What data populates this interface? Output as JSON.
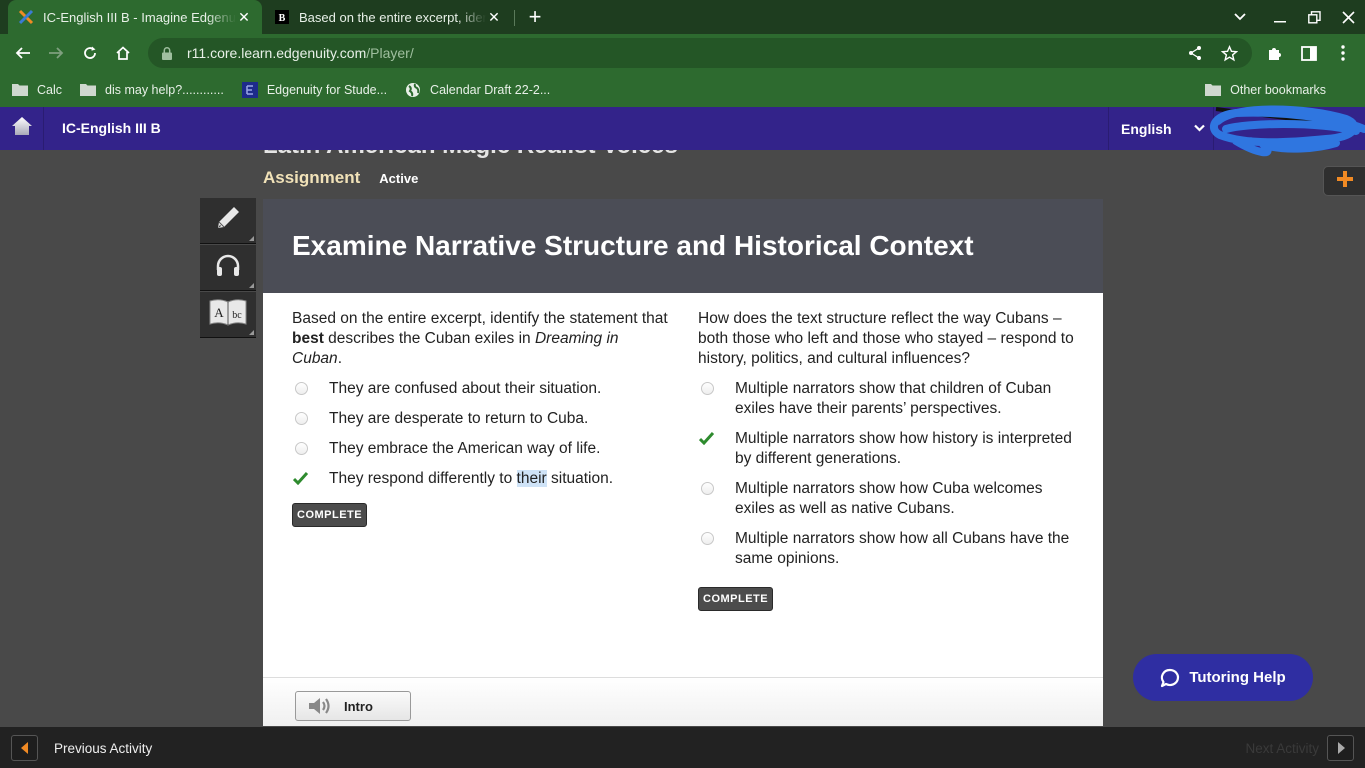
{
  "browser": {
    "tabs": [
      {
        "title": "IC-English III B - Imagine Edgenuity",
        "active": true,
        "favicon": "edgenuity-x-icon"
      },
      {
        "title": "Based on the entire excerpt, identify the statement",
        "active": false,
        "favicon": "brainly-b-icon"
      }
    ],
    "new_tab_label": "+",
    "url_host": "r11.core.learn.edgenuity.com",
    "url_path": "/Player/",
    "bookmarks": [
      {
        "label": "Calc",
        "icon": "folder-icon"
      },
      {
        "label": "dis may help?............",
        "icon": "folder-icon"
      },
      {
        "label": "Edgenuity for Stude...",
        "icon": "edgenuity-icon"
      },
      {
        "label": "Calendar Draft 22-2...",
        "icon": "globe-icon"
      }
    ],
    "other_bookmarks": "Other bookmarks"
  },
  "app": {
    "course_title": "IC-English III B",
    "language": "English",
    "unit_title": "Latin American Magic Realist Voices",
    "activity_type": "Assignment",
    "activity_status": "Active",
    "lesson_title": "Examine Narrative Structure and Historical Context"
  },
  "questions": [
    {
      "prompt_parts": {
        "pre": "Based on the entire excerpt, identify the statement that ",
        "bold": "best",
        "mid": " describes the Cuban exiles in ",
        "italic": "Dreaming in Cuban",
        "post": "."
      },
      "options": [
        {
          "text": "They are confused about their situation.",
          "selected": false
        },
        {
          "text": "They are desperate to return to Cuba.",
          "selected": false
        },
        {
          "text": "They embrace the American way of life.",
          "selected": false
        },
        {
          "text_pre": "They respond differently to ",
          "text_hl": "their",
          "text_post": " situation.",
          "selected": true
        }
      ],
      "status": "COMPLETE"
    },
    {
      "prompt": "How does the text structure reflect the way Cubans – both those who left and those who stayed – respond to history, politics, and cultural influences?",
      "options": [
        {
          "text": "Multiple narrators show that children of Cuban exiles have their parents’ perspectives.",
          "selected": false
        },
        {
          "text": "Multiple narrators show how history is interpreted by different generations.",
          "selected": true
        },
        {
          "text": "Multiple narrators show how Cuba welcomes exiles as well as native Cubans.",
          "selected": false
        },
        {
          "text": "Multiple narrators show how all Cubans have the same opinions.",
          "selected": false
        }
      ],
      "status": "COMPLETE"
    }
  ],
  "footer": {
    "intro_label": "Intro",
    "tutoring_label": "Tutoring Help",
    "previous_label": "Previous Activity",
    "next_label": "Next Activity"
  },
  "colors": {
    "browser_frame": "#2d6a2f",
    "app_header": "#33238a",
    "lesson_header": "#4b4d56",
    "assignment_label": "#f1e2b8",
    "check": "#2e8b2e",
    "tutoring_button": "#2f2ea2",
    "accent_orange": "#f08a24"
  }
}
